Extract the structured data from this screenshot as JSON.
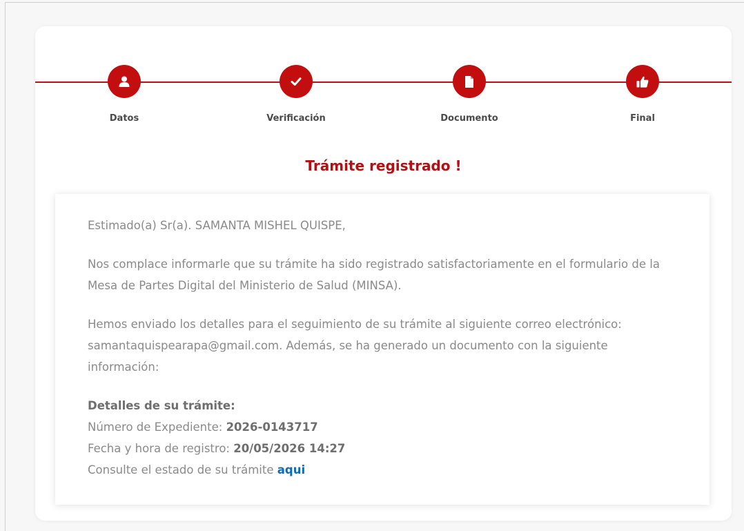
{
  "stepper": {
    "steps": [
      {
        "label": "Datos",
        "icon": "user-icon"
      },
      {
        "label": "Verificación",
        "icon": "check-icon"
      },
      {
        "label": "Documento",
        "icon": "document-icon"
      },
      {
        "label": "Final",
        "icon": "thumbs-up-icon"
      }
    ],
    "accent_color": "#c20e0e"
  },
  "title": "Trámite registrado !",
  "message": {
    "greeting": "Estimado(a) Sr(a). SAMANTA MISHEL QUISPE,",
    "paragraph1": "Nos complace informarle que su trámite ha sido registrado satisfactoriamente en el formulario de la Mesa de Partes Digital del Ministerio de Salud (MINSA).",
    "paragraph2": "Hemos enviado los detalles para el seguimiento de su trámite al siguiente correo electrónico: samantaquispearapa@gmail.com. Además, se ha generado un documento con la siguiente información:",
    "details_heading": "Detalles de su trámite:",
    "expediente_label": "Número de Expediente: ",
    "expediente_value": "2026-0143717",
    "fecha_label": "Fecha y hora de registro: ",
    "fecha_value": "20/05/2026 14:27",
    "consulte_text": "Consulte el estado de su trámite ",
    "consulte_link": "aqui"
  }
}
